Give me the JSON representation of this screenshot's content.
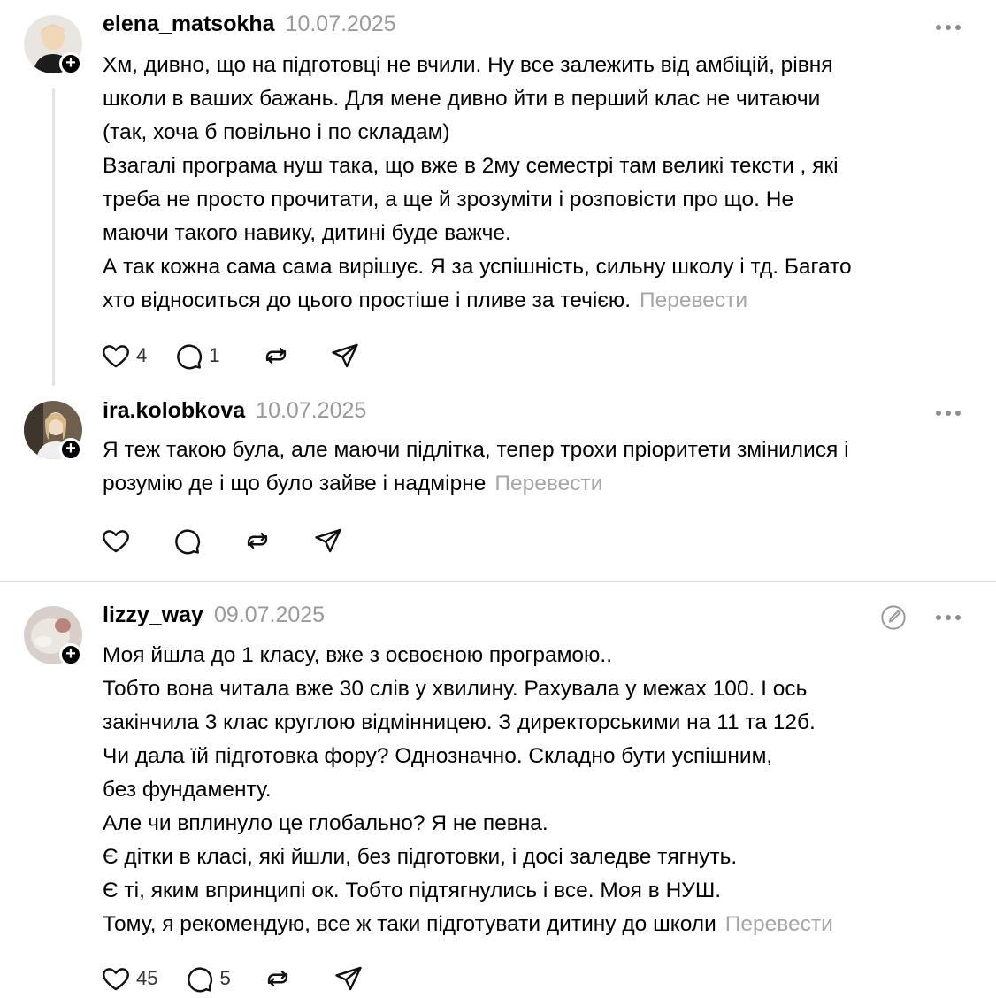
{
  "translate_label": "Перевести",
  "posts": [
    {
      "username": "elena_matsokha",
      "date": "10.07.2025",
      "text": "Хм, дивно, що на підготовці не вчили. Ну все залежить від амбіцій, рівня\nшколи в ваших бажань. Для мене дивно йти в перший клас не читаючи\n(так, хоча б повільно і по складам)\nВзагалі програма нуш така, що вже в 2му семестрі там великі тексти , які\nтреба не просто прочитати, а ще й зрозуміти і розповісти про що. Не\nмаючи такого навику, дитині буде важче.\nА так кожна сама сама вирішує. Я за успішність, сильну школу і тд. Багато\nхто відноситься до цього простіше і пливе за течією.",
      "likes": "4",
      "replies": "1"
    },
    {
      "username": "ira.kolobkova",
      "date": "10.07.2025",
      "text": "Я теж такою була, але маючи підлітка, тепер трохи пріоритети змінилися і\nрозумію де і що було зайве і надмірне",
      "likes": "",
      "replies": ""
    },
    {
      "username": "lizzy_way",
      "date": "09.07.2025",
      "text": "Моя йшла до 1 класу, вже з освоєною програмою..\nТобто вона читала вже 30 слів у хвилину. Рахувала у межах 100. І ось\nзакінчила 3 клас круглою відмінницею. З директорськими на 11 та 12б.\nЧи дала їй підготовка фору? Однозначно. Складно бути успішним,\nбез фундаменту.\nАле чи вплинуло це глобально? Я не певна.\nЄ дітки в класі, які йшли, без підготовки, і досі заледве тягнуть.\nЄ ті, яким впринципі ок. Тобто підтягнулись і все. Моя в НУШ.\nТому, я рекомендую, все ж таки підготувати дитину до школи",
      "likes": "45",
      "replies": "5"
    }
  ],
  "icons": {
    "like": "heart-icon",
    "reply": "comment-icon",
    "repost": "repost-icon",
    "share": "send-icon",
    "more": "more-icon",
    "edit": "edit-icon",
    "follow": "plus-icon"
  },
  "colors": {
    "muted": "#9a9a9a",
    "divider": "#dcdcdc",
    "thread_line": "#e4e4e4"
  }
}
